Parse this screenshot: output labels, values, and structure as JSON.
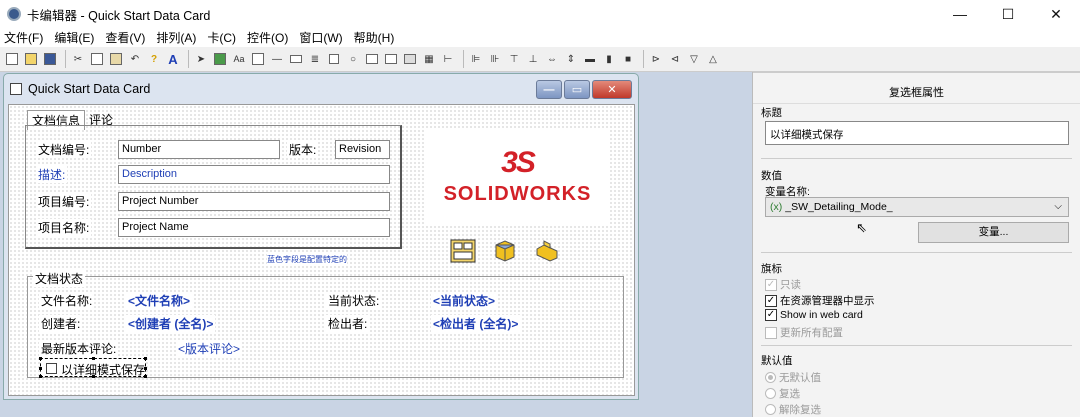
{
  "window": {
    "title": "卡编辑器 - Quick Start Data Card",
    "min_glyph": "—",
    "max_glyph": "☐",
    "close_glyph": "✕"
  },
  "menu": [
    "文件(F)",
    "编辑(E)",
    "查看(V)",
    "排列(A)",
    "卡(C)",
    "控件(O)",
    "窗口(W)",
    "帮助(H)"
  ],
  "toolbar_icons": [
    "new-icon",
    "open-icon",
    "save-icon",
    "cut-icon",
    "copy-icon",
    "paste-icon",
    "undo-icon",
    "help-icon",
    "text-a-icon",
    "pointer-icon",
    "image-icon",
    "label-icon",
    "textbox-icon",
    "line-icon",
    "combo-icon",
    "list-icon",
    "checkbox-icon",
    "radio-icon",
    "group-icon",
    "tab-icon",
    "button-icon",
    "tree-icon",
    "align-icon",
    "distribute-icon",
    "size-icon"
  ],
  "card_window": {
    "title": "Quick Start Data Card",
    "min": "—",
    "max": "▭",
    "close": "✕"
  },
  "card": {
    "tabs": [
      "文档信息",
      "评论"
    ],
    "fields": {
      "doc_no_label": "文档编号:",
      "doc_no_value": "Number",
      "version_label": "版本:",
      "version_value": "Revision",
      "desc_label": "描述:",
      "desc_value": "Description",
      "proj_no_label": "项目编号:",
      "proj_no_value": "Project Number",
      "proj_name_label": "项目名称:",
      "proj_name_value": "Project Name"
    },
    "logo_mark": "3S",
    "logo_text_a": "SOLID",
    "logo_text_b": "WORKS",
    "note": "蓝色字段是配置特定的",
    "status_group": "文档状态",
    "file_name_label": "文件名称:",
    "file_name_value": "<文件名称>",
    "current_state_label": "当前状态:",
    "current_state_value": "<当前状态>",
    "creator_label": "创建者:",
    "creator_value": "<创建者 (全名)>",
    "checked_out_label": "检出者:",
    "checked_out_value": "<检出者 (全名)>",
    "latest_comment_label": "最新版本评论:",
    "latest_comment_value": "<版本评论>",
    "checkbox_label": "以详细模式保存"
  },
  "panel": {
    "title": "复选框属性",
    "caption_section": "标题",
    "caption_value": "以详细模式保存",
    "value_section": "数值",
    "var_name_label": "变量名称:",
    "var_name_value": "_SW_Detailing_Mode_",
    "var_prefix": "(x)",
    "var_button": "变量...",
    "flags_section": "旗标",
    "flags": [
      {
        "label": "只读",
        "checked": true,
        "disabled": true
      },
      {
        "label": "在资源管理器中显示",
        "checked": true,
        "disabled": false
      },
      {
        "label": "Show in web card",
        "checked": true,
        "disabled": false
      },
      {
        "label": "更新所有配置",
        "checked": false,
        "disabled": true
      }
    ],
    "default_section": "默认值",
    "defaults": [
      {
        "label": "无默认值",
        "selected": true
      },
      {
        "label": "复选",
        "selected": false
      },
      {
        "label": "解除复选",
        "selected": false
      }
    ]
  }
}
